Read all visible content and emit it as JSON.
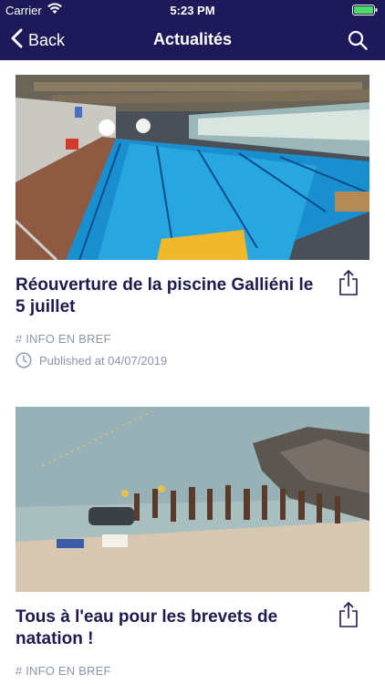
{
  "status_bar": {
    "carrier": "Carrier",
    "time": "5:23 PM"
  },
  "nav": {
    "back_label": "Back",
    "title": "Actualités"
  },
  "articles": [
    {
      "title": "Réouverture de la piscine Galliéni le 5 juillet",
      "tag": "# INFO EN BREF",
      "published": "Published at 04/07/2019"
    },
    {
      "title": "Tous à l'eau pour les brevets de natation !",
      "tag": "# INFO EN BREF"
    }
  ],
  "colors": {
    "bar": "#1e1a5a",
    "text": "#1d1b4f",
    "meta": "#8a96ab",
    "battery": "#4cd964"
  }
}
